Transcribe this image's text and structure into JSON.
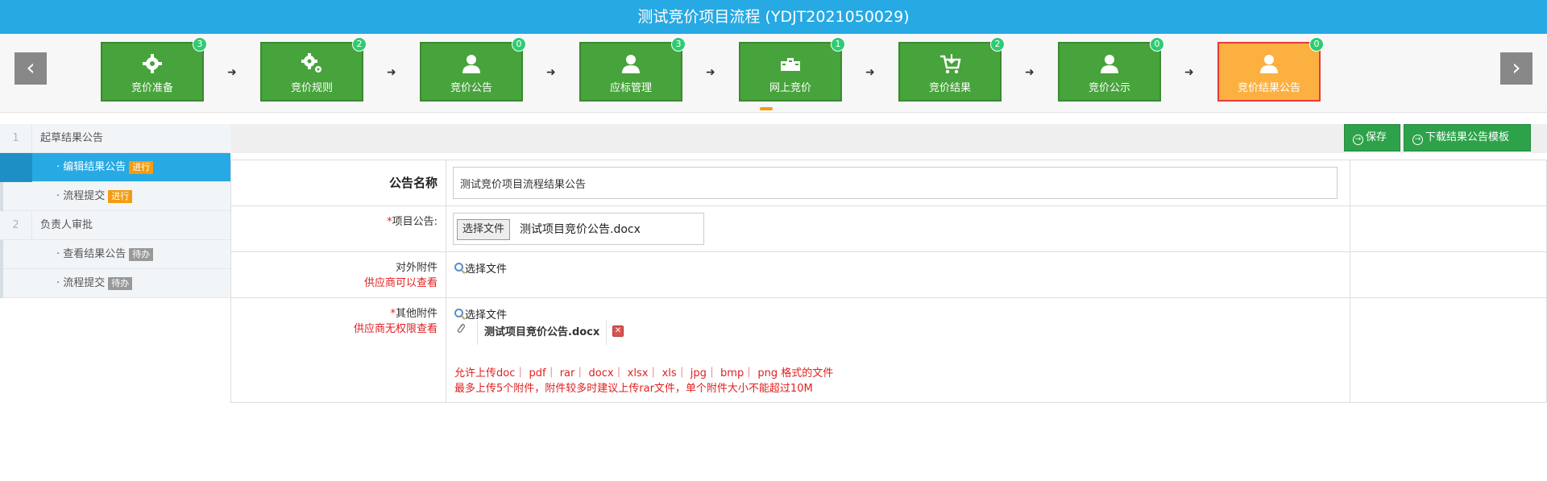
{
  "title": "测试竞价项目流程 (YDJT2021050029)",
  "nav": {
    "prev_glyph": "‹",
    "next_glyph": "›",
    "separator_glyph": "➜"
  },
  "steps": [
    {
      "label": "竞价准备",
      "badge": "3",
      "icon": "gear-icon"
    },
    {
      "label": "竞价规则",
      "badge": "2",
      "icon": "gears-icon"
    },
    {
      "label": "竞价公告",
      "badge": "0",
      "icon": "user-icon"
    },
    {
      "label": "应标管理",
      "badge": "3",
      "icon": "user-icon"
    },
    {
      "label": "网上竞价",
      "badge": "1",
      "icon": "bid-icon"
    },
    {
      "label": "竞价结果",
      "badge": "2",
      "icon": "cart-icon"
    },
    {
      "label": "竞价公示",
      "badge": "0",
      "icon": "user-icon"
    },
    {
      "label": "竞价结果公告",
      "badge": "0",
      "icon": "user-icon",
      "current": true
    }
  ],
  "sidebar": {
    "groups": [
      {
        "num": "1",
        "label": "起草结果公告"
      },
      {
        "num": "2",
        "label": "负责人审批"
      }
    ],
    "items": [
      {
        "label": "· 编辑结果公告",
        "tag": "进行"
      },
      {
        "label": "· 流程提交",
        "tag": "进行"
      },
      {
        "label": "· 查看结果公告",
        "tag": "待办"
      },
      {
        "label": "· 流程提交",
        "tag": "待办"
      }
    ]
  },
  "toolbar": {
    "save_label": "保存",
    "download_label": "下载结果公告模板",
    "btn_glyph": "→"
  },
  "form": {
    "name_label": "公告名称",
    "name_value": "测试竞价项目流程结果公告",
    "req_star": "*",
    "project_label": "项目公告:",
    "file_button": "选择文件",
    "project_file": "测试项目竞价公告.docx",
    "external_label": "对外附件",
    "external_note": "供应商可以查看",
    "select_file": "选择文件",
    "other_label": "其他附件",
    "other_note": "供应商无权限查看",
    "attachment": "测试项目竞价公告.docx",
    "delete_glyph": "✕",
    "rule1": "允许上传doc｜ pdf｜ rar｜ docx｜ xlsx｜ xls｜ jpg｜ bmp｜ png 格式的文件",
    "rule2": "最多上传5个附件，附件较多时建议上传rar文件，单个附件大小不能超过10M"
  },
  "colors": {
    "title_bg": "#27a9e3",
    "step_green": "#47a33b",
    "step_current": "#fbb040",
    "badge_green": "#2ecc71",
    "button_green": "#2ea24a",
    "required_red": "#e02020",
    "tag_orange": "#f39c12",
    "tag_gray": "#999999"
  }
}
